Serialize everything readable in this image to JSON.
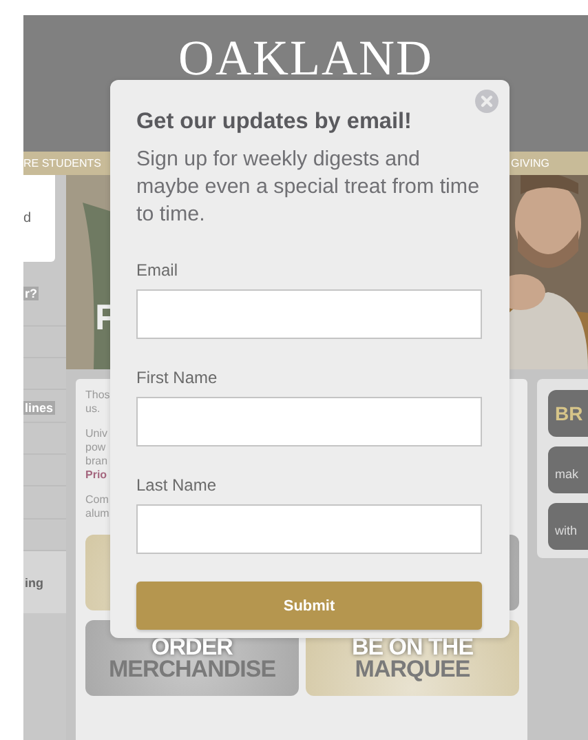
{
  "header": {
    "logo": "OAKLAND"
  },
  "nav": {
    "items": [
      "RE STUDENTS",
      "GIVING"
    ]
  },
  "sidebar": {
    "card_text": "d",
    "items": [
      {
        "label": "r?"
      },
      {
        "label": "lines"
      },
      {
        "label": "ing"
      }
    ]
  },
  "hero": {
    "kind": "picture",
    "title": "F"
  },
  "intro": {
    "paragraphs": [
      [
        "Thos",
        "us."
      ],
      [
        "Univ",
        "pow",
        "bran",
        "**Prio**"
      ],
      [
        "Com",
        "alum"
      ]
    ]
  },
  "tiles": [
    {
      "kind": "gold"
    },
    {
      "kind": "silver"
    },
    {
      "lines": [
        "ORDER",
        "MERCHANDISE"
      ],
      "kind": "silver"
    },
    {
      "lines": [
        "BE ON THE",
        "MARQUEE"
      ],
      "kind": "gold"
    }
  ],
  "side_buttons": [
    {
      "label": "BR",
      "kind": "title"
    },
    {
      "label": "mak",
      "kind": "text"
    },
    {
      "label": "with",
      "kind": "text"
    }
  ],
  "popup": {
    "title": "Get our updates by email!",
    "text": "Sign up for weekly digests and maybe even a special treat from time to time.",
    "fields": [
      {
        "label": "Email"
      },
      {
        "label": "First Name"
      },
      {
        "label": "Last Name"
      }
    ],
    "submit": "Submit"
  }
}
